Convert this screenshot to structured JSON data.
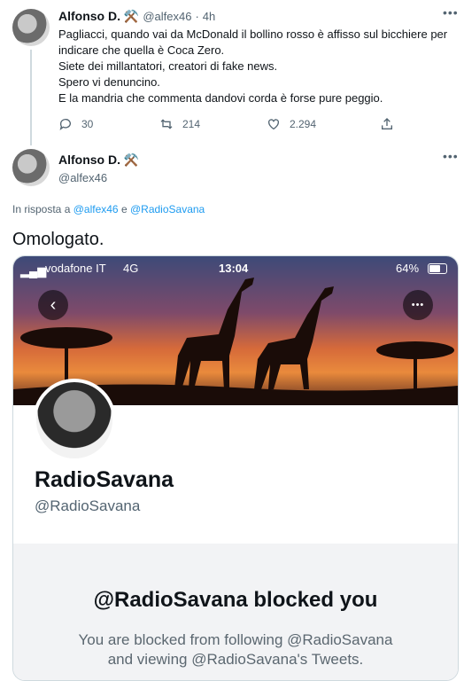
{
  "tweet1": {
    "author": "Alfonso D. ⚒️",
    "handle": "@alfex46",
    "sep": "·",
    "time": "4h",
    "lines": [
      "Pagliacci, quando vai da McDonald il bollino rosso è affisso sul bicchiere per",
      "indicare che quella è Coca Zero.",
      "Siete dei millantatori, creatori di fake news.",
      "Spero vi denuncino.",
      "E la mandria che commenta dandovi corda è forse pure peggio."
    ],
    "replies": "30",
    "retweets": "214",
    "likes": "2.294"
  },
  "tweet2": {
    "author": "Alfonso D. ⚒️",
    "handle": "@alfex46",
    "reply_prefix": "In risposta a",
    "reply_user1": "@alfex46",
    "reply_and": "e",
    "reply_user2": "@RadioSavana",
    "text": "Omologato."
  },
  "screenshot": {
    "carrier": "vodafone IT",
    "network": "4G",
    "clock": "13:04",
    "battery": "64%",
    "profile_name": "RadioSavana",
    "profile_handle": "@RadioSavana",
    "blocked_title": "@RadioSavana blocked you",
    "blocked_line1": "You are blocked from following @RadioSavana",
    "blocked_line2": "and viewing @RadioSavana's Tweets."
  },
  "icons": [
    "reply-icon",
    "retweet-icon",
    "like-icon",
    "share-icon",
    "more-icon",
    "back-icon"
  ]
}
